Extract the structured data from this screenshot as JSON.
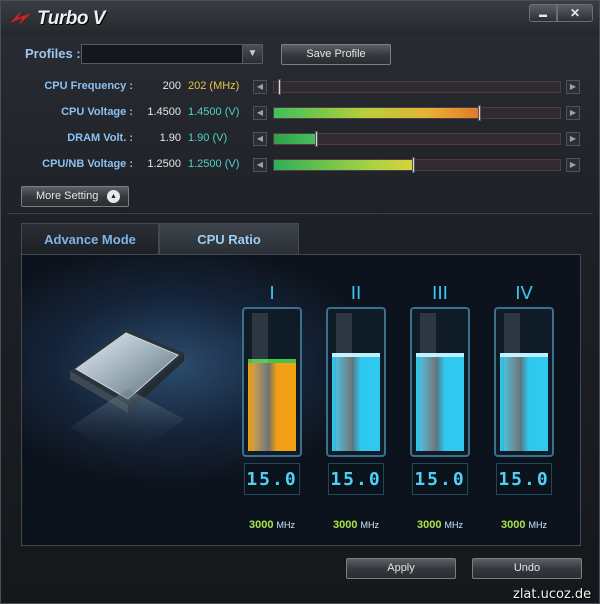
{
  "app": {
    "title": "Turbo V",
    "brand_color": "#d91f26",
    "minimize_icon": "minimize-icon",
    "close_icon": "close-icon",
    "minimize_glyph": "▬",
    "close_glyph": "✕"
  },
  "profiles": {
    "label": "Profiles :",
    "selected_value": "",
    "save_label": "Save Profile",
    "dropdown_glyph": "▼"
  },
  "sliders": [
    {
      "label": "CPU Frequency :",
      "current": "200",
      "target": "202 (MHz)",
      "target_color": "#e8c64a",
      "level": 0.02,
      "fill": "none"
    },
    {
      "label": "CPU Voltage :",
      "current": "1.4500",
      "target": "1.4500 (V)",
      "target_color": "#4ed4c8",
      "level": 0.72,
      "fill": "gradient"
    },
    {
      "label": "DRAM Volt. :",
      "current": "1.90",
      "target": "1.90 (V)",
      "target_color": "#4ed4c8",
      "level": 0.15,
      "fill": "green"
    },
    {
      "label": "CPU/NB Voltage :",
      "current": "1.2500",
      "target": "1.2500 (V)",
      "target_color": "#4ed4c8",
      "level": 0.49,
      "fill": "yellowgreen"
    }
  ],
  "more_setting": {
    "label": "More Setting",
    "icon": "chevron-up-icon",
    "glyph": "▲"
  },
  "tabs": [
    {
      "label": "Advance Mode",
      "active": false
    },
    {
      "label": "CPU Ratio",
      "active": true
    }
  ],
  "cores": [
    {
      "label": "I",
      "ratio": "15.0",
      "freq": "3000",
      "unit": "MHz",
      "level": 0.62,
      "color": "#f2a016",
      "cap_color": "#45c24a"
    },
    {
      "label": "II",
      "ratio": "15.0",
      "freq": "3000",
      "unit": "MHz",
      "level": 0.66,
      "color": "#2fc9f0",
      "cap_color": "#bfefff"
    },
    {
      "label": "III",
      "ratio": "15.0",
      "freq": "3000",
      "unit": "MHz",
      "level": 0.66,
      "color": "#2fc9f0",
      "cap_color": "#bfefff"
    },
    {
      "label": "IV",
      "ratio": "15.0",
      "freq": "3000",
      "unit": "MHz",
      "level": 0.66,
      "color": "#2fc9f0",
      "cap_color": "#bfefff"
    }
  ],
  "actions": {
    "apply": "Apply",
    "undo": "Undo"
  },
  "watermark": "zlat.ucoz.de",
  "arrows": {
    "left": "◀",
    "right": "▶"
  }
}
